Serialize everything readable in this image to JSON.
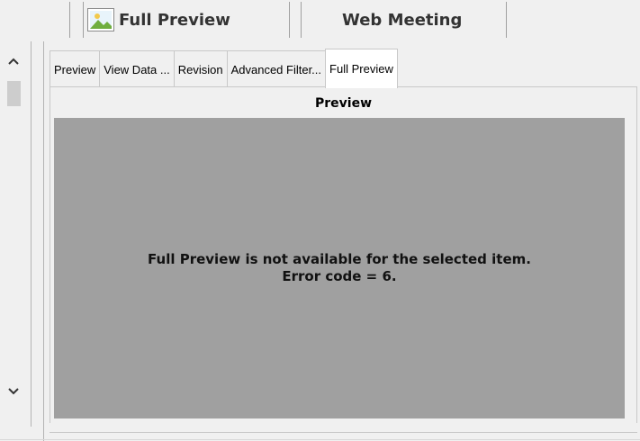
{
  "toolbar": {
    "full_preview_label": "Full Preview",
    "full_preview_icon": "image-icon",
    "web_meeting_label": "Web Meeting"
  },
  "scrollbar": {
    "up_icon": "chevron-up-icon",
    "down_icon": "chevron-down-icon"
  },
  "tabs": [
    {
      "label": "Preview",
      "active": false
    },
    {
      "label": "View Data ...",
      "active": false
    },
    {
      "label": "Revision",
      "active": false
    },
    {
      "label": "Advanced Filter...",
      "active": false
    },
    {
      "label": "Full Preview",
      "active": true
    }
  ],
  "pane": {
    "title": "Preview",
    "message_line1": "Full Preview is not available for the selected item.",
    "message_line2": "Error code = 6."
  },
  "colors": {
    "window_bg": "#f0f0f0",
    "preview_bg": "#a0a0a0",
    "active_tab_bg": "#ffffff"
  }
}
